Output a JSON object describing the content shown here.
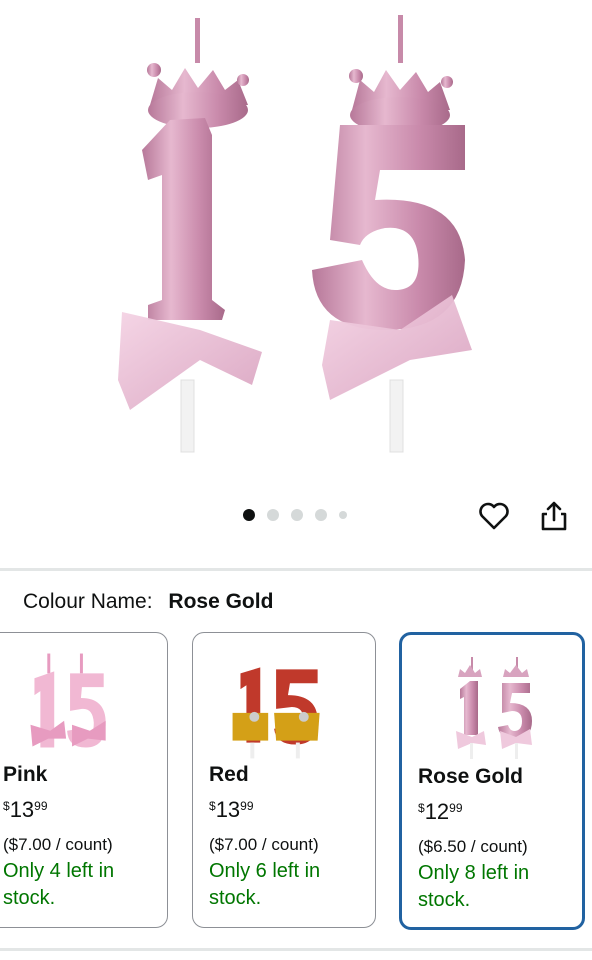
{
  "product_image": {
    "digits": [
      "1",
      "5"
    ],
    "colors": {
      "rose_gold": "#d8a3bf",
      "rose_gold_dark": "#a86a8a",
      "ribbon": "#efc9dd",
      "stick": "#f2f2f2"
    }
  },
  "carousel": {
    "count": 5,
    "active_index": 0
  },
  "actions": {
    "wishlist_icon": "heart-outline",
    "share_icon": "share-arrow"
  },
  "colour": {
    "label": "Colour Name:",
    "value": "Rose Gold"
  },
  "variants": [
    {
      "name": "Pink",
      "currency": "$",
      "price_whole": "13",
      "price_cents": "99",
      "unit_price": "($7.00 / count)",
      "stock": "Only 4 left in stock.",
      "color": "#f1b8d3",
      "accent": "#e79bc0",
      "selected": false
    },
    {
      "name": "Red",
      "currency": "$",
      "price_whole": "13",
      "price_cents": "99",
      "unit_price": "($7.00 / count)",
      "stock": "Only 6 left in stock.",
      "color": "#c0392b",
      "accent": "#d4a017",
      "selected": false
    },
    {
      "name": "Rose Gold",
      "currency": "$",
      "price_whole": "12",
      "price_cents": "99",
      "unit_price": "($6.50 / count)",
      "stock": "Only 8 left in stock.",
      "color": "#d8a3bf",
      "accent": "#a86a8a",
      "selected": true
    }
  ],
  "theme": {
    "selected_border": "#2162a1",
    "stock_green": "#007600",
    "text": "#0f1111"
  }
}
